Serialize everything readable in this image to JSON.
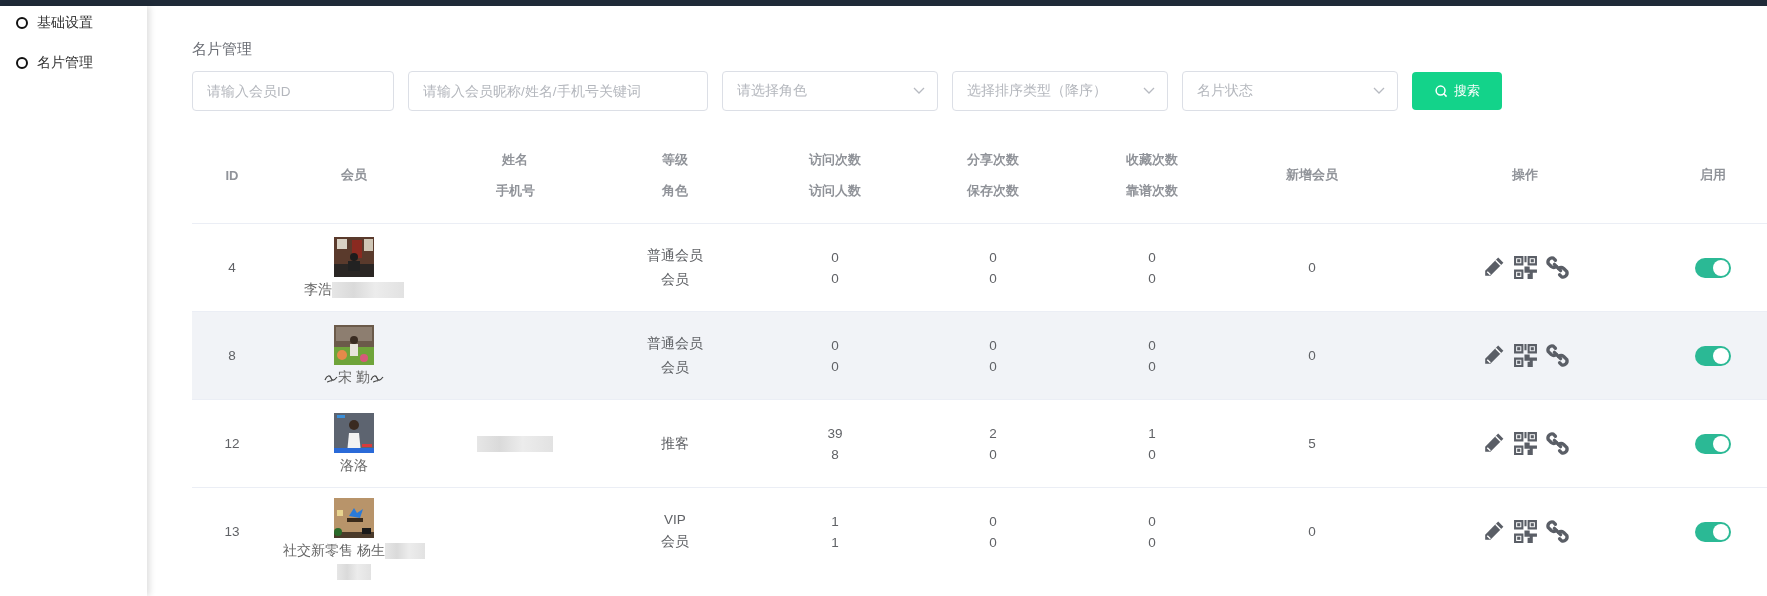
{
  "sidebar": {
    "items": [
      {
        "label": "基础设置"
      },
      {
        "label": "名片管理"
      }
    ]
  },
  "page_title": "名片管理",
  "filters": [
    {
      "kind": "input",
      "placeholder": "请输入会员ID"
    },
    {
      "kind": "input",
      "placeholder": "请输入会员昵称/姓名/手机号关键词"
    },
    {
      "kind": "select",
      "placeholder": "请选择角色"
    },
    {
      "kind": "select",
      "placeholder": "选择排序类型（降序）"
    },
    {
      "kind": "select",
      "placeholder": "名片状态"
    }
  ],
  "search_button": {
    "label": "搜索"
  },
  "table": {
    "columns": [
      {
        "lines": [
          "ID"
        ]
      },
      {
        "lines": [
          "会员"
        ]
      },
      {
        "lines": [
          "姓名",
          "手机号"
        ]
      },
      {
        "lines": [
          "等级",
          "角色"
        ]
      },
      {
        "lines": [
          "访问次数",
          "访问人数"
        ]
      },
      {
        "lines": [
          "分享次数",
          "保存次数"
        ]
      },
      {
        "lines": [
          "收藏次数",
          "靠谱次数"
        ]
      },
      {
        "lines": [
          "新增会员"
        ]
      },
      {
        "lines": [
          "操作"
        ]
      },
      {
        "lines": [
          "启用"
        ]
      }
    ],
    "rows": [
      {
        "id": "4",
        "avatar": {
          "kind": "picture"
        },
        "name": "李浩",
        "name_blurred": true,
        "blur_wraps": false,
        "ornamented": false,
        "phone_redacted": false,
        "level": "普通会员",
        "role": "会员",
        "stats": [
          [
            "0",
            "0"
          ],
          [
            "0",
            "0"
          ],
          [
            "0",
            "0"
          ]
        ],
        "new_members": "0",
        "enabled": true,
        "hovered": false
      },
      {
        "id": "8",
        "avatar": {
          "kind": "picture"
        },
        "name": "宋 勤",
        "name_blurred": false,
        "ornamented": true,
        "phone_redacted": false,
        "level": "普通会员",
        "role": "会员",
        "stats": [
          [
            "0",
            "0"
          ],
          [
            "0",
            "0"
          ],
          [
            "0",
            "0"
          ]
        ],
        "new_members": "0",
        "enabled": true,
        "hovered": true
      },
      {
        "id": "12",
        "avatar": {
          "kind": "picture"
        },
        "name": "洛洛",
        "name_blurred": false,
        "ornamented": false,
        "phone_redacted": true,
        "role": "推客",
        "stats": [
          [
            "39",
            "8"
          ],
          [
            "2",
            "0"
          ],
          [
            "1",
            "0"
          ]
        ],
        "new_members": "5",
        "enabled": true,
        "hovered": false
      },
      {
        "id": "13",
        "avatar": {
          "kind": "picture"
        },
        "name": "社交新零售 杨生",
        "name_blurred": true,
        "blur_wraps": true,
        "ornamented": false,
        "phone_redacted": false,
        "level": "VIP",
        "role": "会员",
        "stats": [
          [
            "1",
            "1"
          ],
          [
            "0",
            "0"
          ],
          [
            "0",
            "0"
          ]
        ],
        "new_members": "0",
        "enabled": true,
        "hovered": false
      }
    ]
  }
}
